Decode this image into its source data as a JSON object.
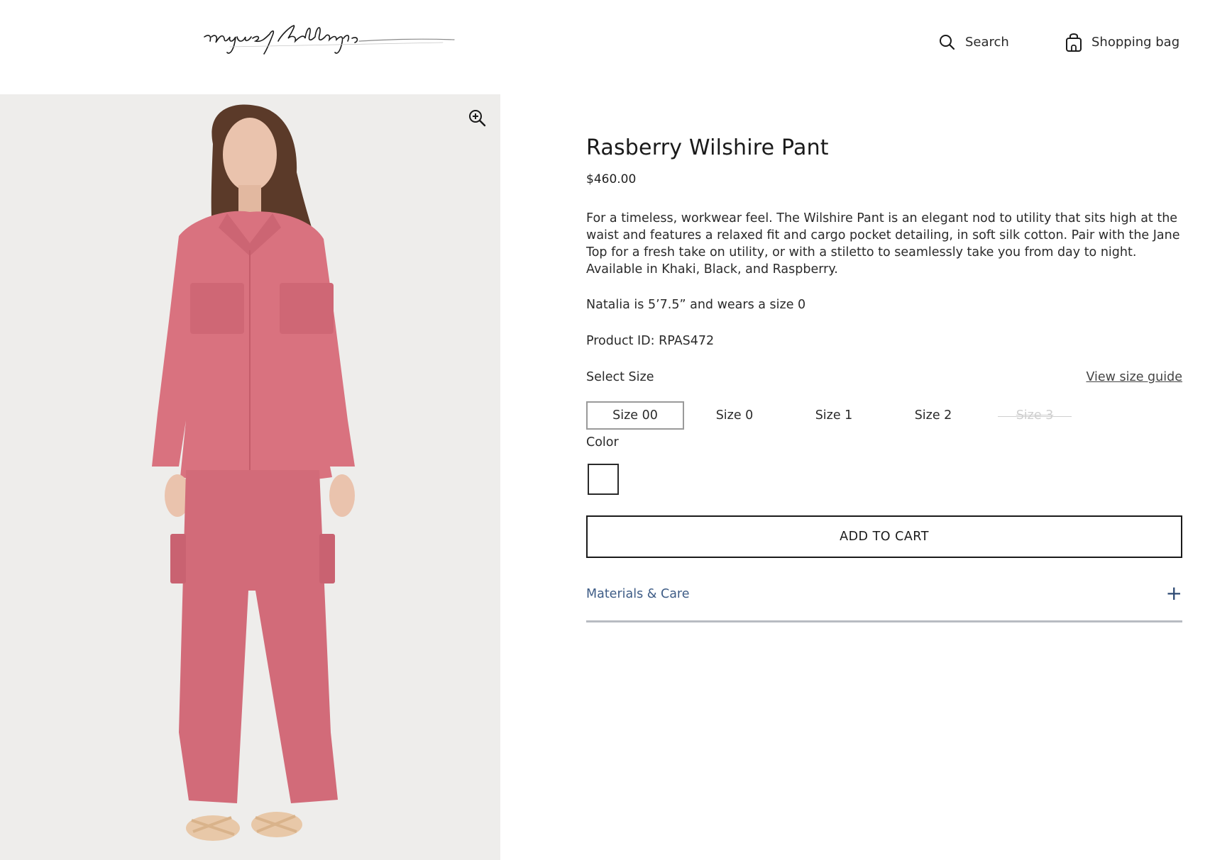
{
  "header": {
    "logo_text": "raquel allegra",
    "search_label": "Search",
    "bag_label": "Shopping bag"
  },
  "product": {
    "title": "Rasberry Wilshire Pant",
    "price": "$460.00",
    "description": "For a timeless, workwear feel. The Wilshire Pant is an elegant nod to utility that sits high at the waist and features a relaxed fit and cargo pocket detailing, in soft silk cotton. Pair with the Jane Top for a fresh take on utility, or with a stiletto to seamlessly take you from day to night. Available in Khaki, Black, and Raspberry.",
    "fit_note": "Natalia is 5’7.5” and wears a size 0",
    "product_id_label": "Product ID: ",
    "product_id": "RPAS472"
  },
  "size": {
    "label": "Select Size",
    "guide_link": "View size guide",
    "options": [
      {
        "label": "Size 00",
        "selected": true,
        "available": true
      },
      {
        "label": "Size 0",
        "selected": false,
        "available": true
      },
      {
        "label": "Size 1",
        "selected": false,
        "available": true
      },
      {
        "label": "Size 2",
        "selected": false,
        "available": true
      },
      {
        "label": "Size 3",
        "selected": false,
        "available": false
      }
    ]
  },
  "color": {
    "label": "Color",
    "swatch_color": "#ffffff"
  },
  "cart": {
    "add_label": "ADD TO CART"
  },
  "accordion": {
    "materials_label": "Materials & Care",
    "toggle": "+"
  },
  "colors": {
    "text": "#1f1f1f",
    "accent_link": "#3e5c86",
    "gallery_bg": "#eeedeb",
    "garment": "#d9727f"
  },
  "icons": {
    "search": "search-icon",
    "bag": "shopping-bag-icon",
    "zoom": "zoom-in-icon",
    "plus": "plus-icon"
  }
}
